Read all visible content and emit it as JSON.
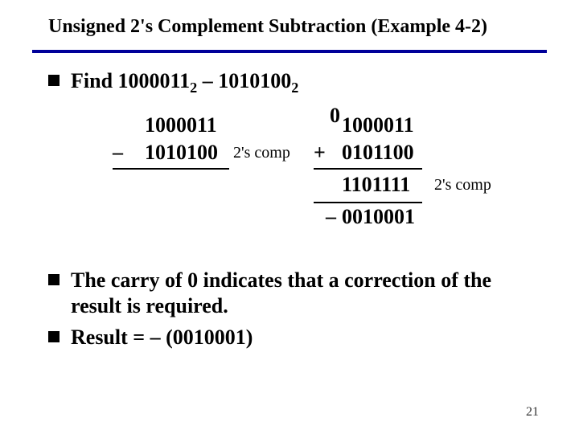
{
  "title": "Unsigned 2's Complement Subtraction (Example 4-2)",
  "bullets": {
    "find_prefix": "Find ",
    "minuend": "1000011",
    "base1": "2",
    "dash": " – ",
    "subtrahend": "1010100",
    "base2": "2",
    "carry_text": "The carry of 0 indicates that a correction of the result is required.",
    "result_text": "Result = – (0010001)"
  },
  "work": {
    "carry": "0",
    "left_top": "1000011",
    "left_minus": "–",
    "left_bottom": "1010100",
    "arrow_label": "2's comp",
    "right_plus": "+",
    "right_top": "1000011",
    "right_bottom": "0101100",
    "right_sum": "1101111",
    "note2": "2's comp",
    "neg": "–",
    "final": "0010001"
  },
  "page": "21"
}
